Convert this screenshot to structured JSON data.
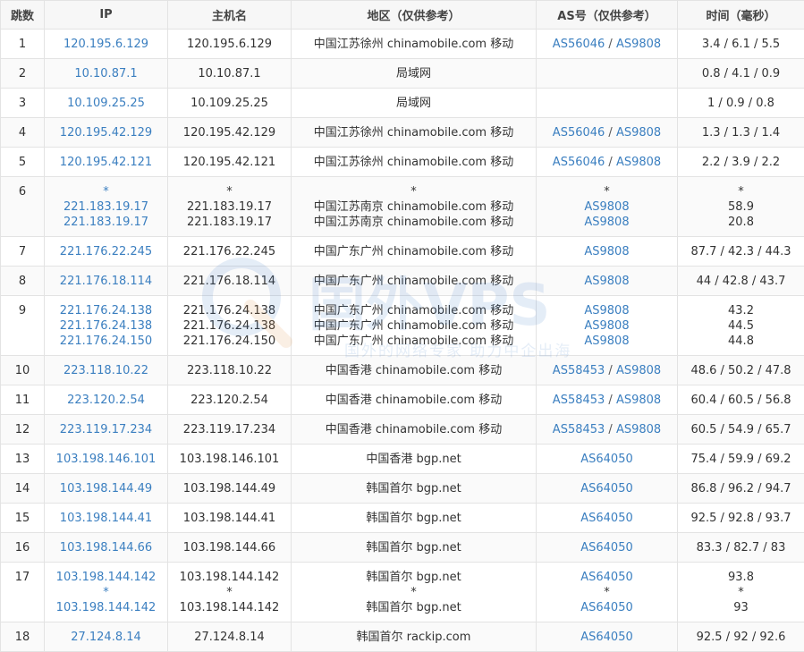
{
  "headers": {
    "hop": "跳数",
    "ip": "IP",
    "host": "主机名",
    "region": "地区（仅供参考）",
    "asn": "AS号（仅供参考）",
    "time": "时间（毫秒）"
  },
  "rows": [
    {
      "hop": "1",
      "ip": [
        "120.195.6.129"
      ],
      "host": [
        "120.195.6.129"
      ],
      "region": [
        "中国江苏徐州 chinamobile.com 移动"
      ],
      "asn": [
        [
          "AS56046",
          "AS9808"
        ]
      ],
      "time": [
        "3.4 / 6.1 / 5.5"
      ]
    },
    {
      "hop": "2",
      "ip": [
        "10.10.87.1"
      ],
      "host": [
        "10.10.87.1"
      ],
      "region": [
        "局域网"
      ],
      "asn": [
        []
      ],
      "time": [
        "0.8 / 4.1 / 0.9"
      ]
    },
    {
      "hop": "3",
      "ip": [
        "10.109.25.25"
      ],
      "host": [
        "10.109.25.25"
      ],
      "region": [
        "局域网"
      ],
      "asn": [
        []
      ],
      "time": [
        "1 / 0.9 / 0.8"
      ]
    },
    {
      "hop": "4",
      "ip": [
        "120.195.42.129"
      ],
      "host": [
        "120.195.42.129"
      ],
      "region": [
        "中国江苏徐州 chinamobile.com 移动"
      ],
      "asn": [
        [
          "AS56046",
          "AS9808"
        ]
      ],
      "time": [
        "1.3 / 1.3 / 1.4"
      ]
    },
    {
      "hop": "5",
      "ip": [
        "120.195.42.121"
      ],
      "host": [
        "120.195.42.121"
      ],
      "region": [
        "中国江苏徐州 chinamobile.com 移动"
      ],
      "asn": [
        [
          "AS56046",
          "AS9808"
        ]
      ],
      "time": [
        "2.2 / 3.9 / 2.2"
      ]
    },
    {
      "hop": "6",
      "ip": [
        "*",
        "221.183.19.17",
        "221.183.19.17"
      ],
      "host": [
        "*",
        "221.183.19.17",
        "221.183.19.17"
      ],
      "region": [
        "*",
        "中国江苏南京 chinamobile.com 移动",
        "中国江苏南京 chinamobile.com 移动"
      ],
      "asn": [
        [
          "*"
        ],
        [
          "AS9808"
        ],
        [
          "AS9808"
        ]
      ],
      "time": [
        "*",
        "58.9",
        "20.8"
      ]
    },
    {
      "hop": "7",
      "ip": [
        "221.176.22.245"
      ],
      "host": [
        "221.176.22.245"
      ],
      "region": [
        "中国广东广州 chinamobile.com 移动"
      ],
      "asn": [
        [
          "AS9808"
        ]
      ],
      "time": [
        "87.7 / 42.3 / 44.3"
      ]
    },
    {
      "hop": "8",
      "ip": [
        "221.176.18.114"
      ],
      "host": [
        "221.176.18.114"
      ],
      "region": [
        "中国广东广州 chinamobile.com 移动"
      ],
      "asn": [
        [
          "AS9808"
        ]
      ],
      "time": [
        "44 / 42.8 / 43.7"
      ]
    },
    {
      "hop": "9",
      "ip": [
        "221.176.24.138",
        "221.176.24.138",
        "221.176.24.150"
      ],
      "host": [
        "221.176.24.138",
        "221.176.24.138",
        "221.176.24.150"
      ],
      "region": [
        "中国广东广州 chinamobile.com 移动",
        "中国广东广州 chinamobile.com 移动",
        "中国广东广州 chinamobile.com 移动"
      ],
      "asn": [
        [
          "AS9808"
        ],
        [
          "AS9808"
        ],
        [
          "AS9808"
        ]
      ],
      "time": [
        "43.2",
        "44.5",
        "44.8"
      ]
    },
    {
      "hop": "10",
      "ip": [
        "223.118.10.22"
      ],
      "host": [
        "223.118.10.22"
      ],
      "region": [
        "中国香港 chinamobile.com 移动"
      ],
      "asn": [
        [
          "AS58453",
          "AS9808"
        ]
      ],
      "time": [
        "48.6 / 50.2 / 47.8"
      ]
    },
    {
      "hop": "11",
      "ip": [
        "223.120.2.54"
      ],
      "host": [
        "223.120.2.54"
      ],
      "region": [
        "中国香港 chinamobile.com 移动"
      ],
      "asn": [
        [
          "AS58453",
          "AS9808"
        ]
      ],
      "time": [
        "60.4 / 60.5 / 56.8"
      ]
    },
    {
      "hop": "12",
      "ip": [
        "223.119.17.234"
      ],
      "host": [
        "223.119.17.234"
      ],
      "region": [
        "中国香港 chinamobile.com 移动"
      ],
      "asn": [
        [
          "AS58453",
          "AS9808"
        ]
      ],
      "time": [
        "60.5 / 54.9 / 65.7"
      ]
    },
    {
      "hop": "13",
      "ip": [
        "103.198.146.101"
      ],
      "host": [
        "103.198.146.101"
      ],
      "region": [
        "中国香港 bgp.net"
      ],
      "asn": [
        [
          "AS64050"
        ]
      ],
      "time": [
        "75.4 / 59.9 / 69.2"
      ]
    },
    {
      "hop": "14",
      "ip": [
        "103.198.144.49"
      ],
      "host": [
        "103.198.144.49"
      ],
      "region": [
        "韩国首尔 bgp.net"
      ],
      "asn": [
        [
          "AS64050"
        ]
      ],
      "time": [
        "86.8 / 96.2 / 94.7"
      ]
    },
    {
      "hop": "15",
      "ip": [
        "103.198.144.41"
      ],
      "host": [
        "103.198.144.41"
      ],
      "region": [
        "韩国首尔 bgp.net"
      ],
      "asn": [
        [
          "AS64050"
        ]
      ],
      "time": [
        "92.5 / 92.8 / 93.7"
      ]
    },
    {
      "hop": "16",
      "ip": [
        "103.198.144.66"
      ],
      "host": [
        "103.198.144.66"
      ],
      "region": [
        "韩国首尔 bgp.net"
      ],
      "asn": [
        [
          "AS64050"
        ]
      ],
      "time": [
        "83.3 / 82.7 / 83"
      ]
    },
    {
      "hop": "17",
      "ip": [
        "103.198.144.142",
        "*",
        "103.198.144.142"
      ],
      "host": [
        "103.198.144.142",
        "*",
        "103.198.144.142"
      ],
      "region": [
        "韩国首尔 bgp.net",
        "*",
        "韩国首尔 bgp.net"
      ],
      "asn": [
        [
          "AS64050"
        ],
        [
          "*"
        ],
        [
          "AS64050"
        ]
      ],
      "time": [
        "93.8",
        "*",
        "93"
      ]
    },
    {
      "hop": "18",
      "ip": [
        "27.124.8.14"
      ],
      "host": [
        "27.124.8.14"
      ],
      "region": [
        "韩国首尔 rackip.com"
      ],
      "asn": [
        [
          "AS64050"
        ]
      ],
      "time": [
        "92.5 / 92 / 92.6"
      ]
    }
  ],
  "watermark": {
    "logo_text": "国外VPS",
    "tagline": "国外的网络专家 助力中企出海"
  },
  "colors": {
    "link": "#3b7fc0",
    "border": "#e3e3e3",
    "header_bg": "#f7f7f7"
  }
}
